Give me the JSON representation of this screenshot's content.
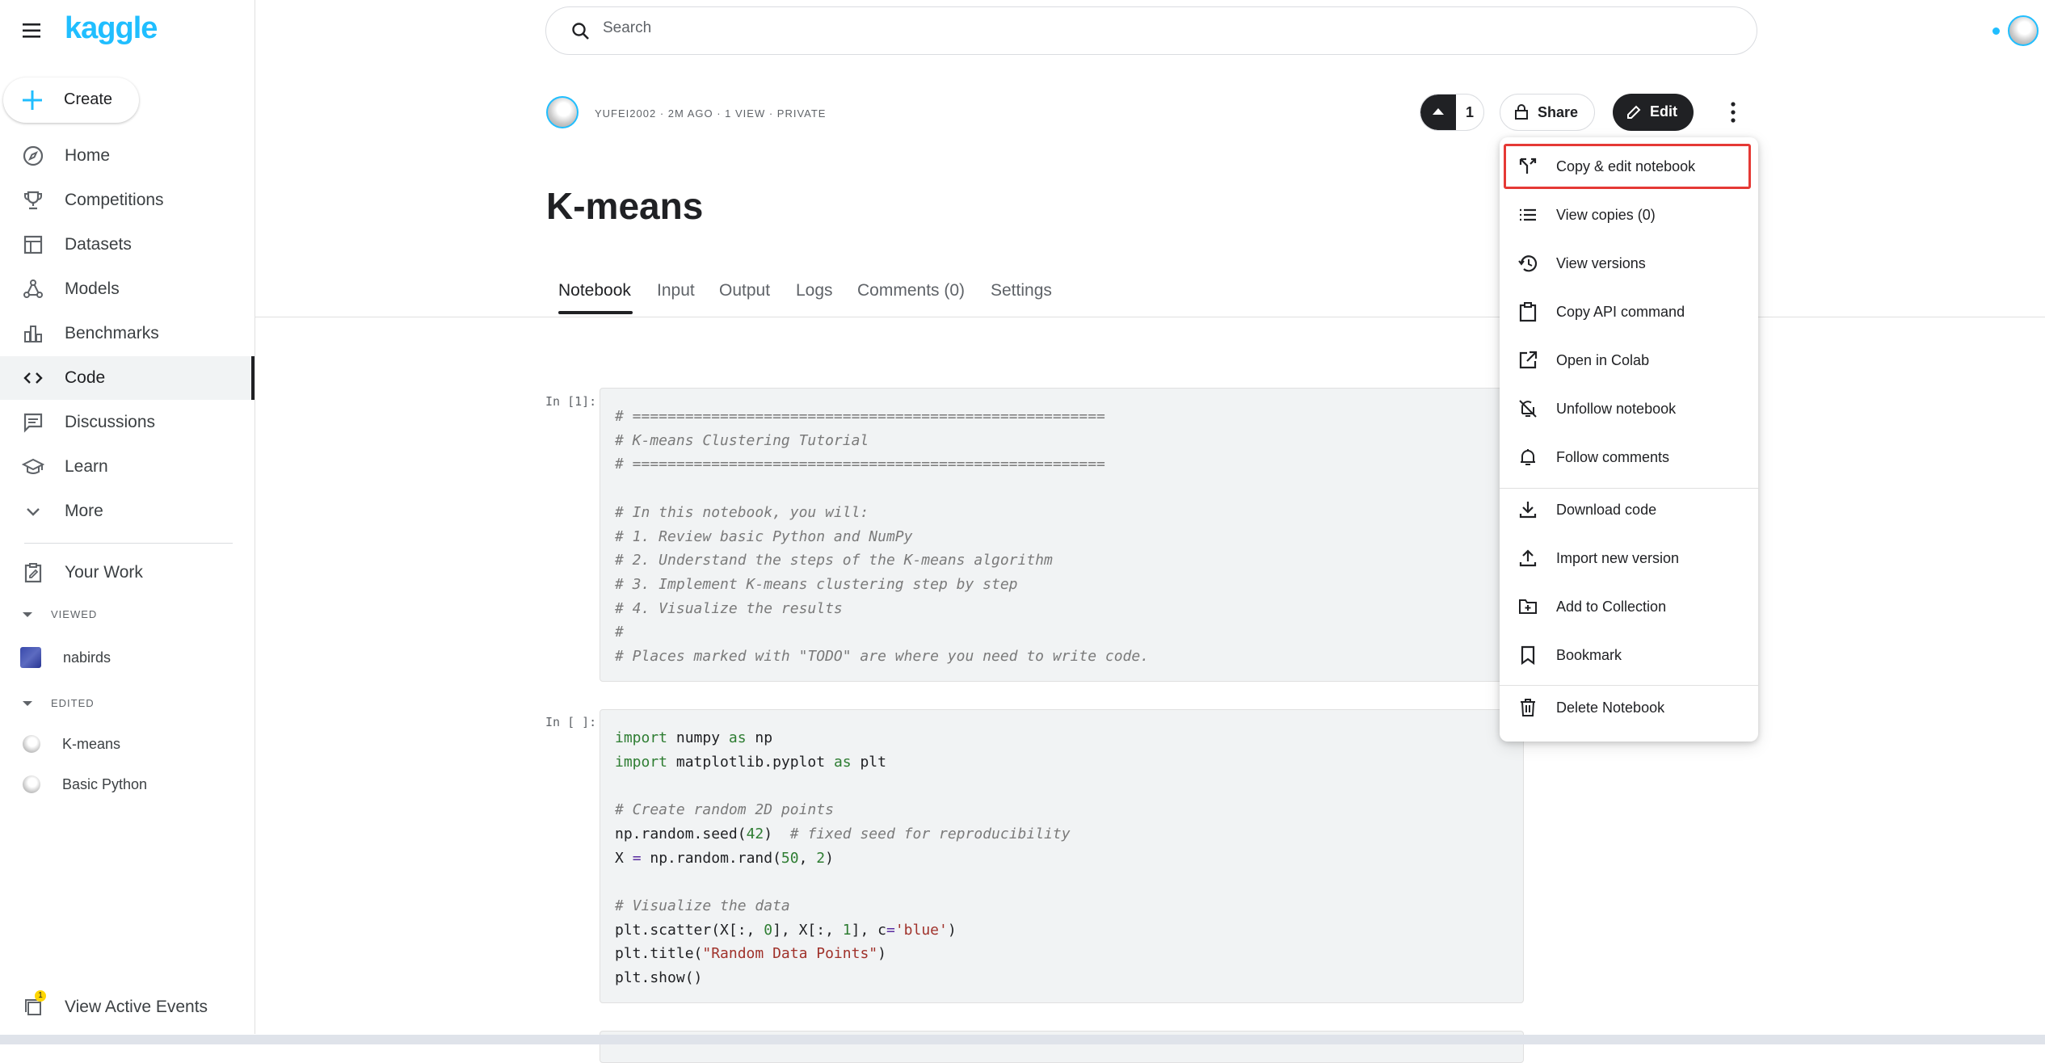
{
  "brand": {
    "logo_text": "kaggle",
    "accent": "#20beff"
  },
  "sidebar": {
    "create_label": "Create",
    "items": [
      {
        "label": "Home",
        "icon": "compass-icon"
      },
      {
        "label": "Competitions",
        "icon": "trophy-icon"
      },
      {
        "label": "Datasets",
        "icon": "table-icon"
      },
      {
        "label": "Models",
        "icon": "models-icon"
      },
      {
        "label": "Benchmarks",
        "icon": "bar-chart-icon"
      },
      {
        "label": "Code",
        "icon": "code-icon",
        "active": true
      },
      {
        "label": "Discussions",
        "icon": "discussion-icon"
      },
      {
        "label": "Learn",
        "icon": "graduation-cap-icon"
      },
      {
        "label": "More",
        "icon": "chevron-down-icon"
      }
    ],
    "your_work_label": "Your Work",
    "viewed_label": "VIEWED",
    "viewed_items": [
      "nabirds"
    ],
    "edited_label": "EDITED",
    "edited_items": [
      "K-means",
      "Basic Python"
    ],
    "events_label": "View Active Events",
    "events_badge": "1"
  },
  "search": {
    "placeholder": "Search"
  },
  "notebook": {
    "meta": "YUFEI2002 · 2M AGO · 1 VIEW · PRIVATE",
    "title": "K-means",
    "vote_count": "1",
    "share_label": "Share",
    "edit_label": "Edit",
    "tabs": [
      "Notebook",
      "Input",
      "Output",
      "Logs",
      "Comments (0)",
      "Settings"
    ],
    "cells": [
      {
        "prompt": "In [1]:"
      },
      {
        "prompt": "In [ ]:"
      }
    ]
  },
  "menu": {
    "items": [
      {
        "label": "Copy & edit notebook",
        "icon": "fork-icon",
        "highlighted": true
      },
      {
        "label": "View copies (0)",
        "icon": "list-icon"
      },
      {
        "label": "View versions",
        "icon": "history-icon"
      },
      {
        "label": "Copy API command",
        "icon": "clipboard-icon"
      },
      {
        "label": "Open in Colab",
        "icon": "external-link-icon"
      },
      {
        "label": "Unfollow notebook",
        "icon": "bell-off-icon"
      },
      {
        "label": "Follow comments",
        "icon": "bell-icon"
      },
      {
        "label": "Download code",
        "icon": "download-icon"
      },
      {
        "label": "Import new version",
        "icon": "upload-icon"
      },
      {
        "label": "Add to Collection",
        "icon": "folder-add-icon"
      },
      {
        "label": "Bookmark",
        "icon": "bookmark-icon"
      },
      {
        "label": "Delete Notebook",
        "icon": "trash-icon"
      }
    ],
    "highlight_color": "#e53935"
  }
}
